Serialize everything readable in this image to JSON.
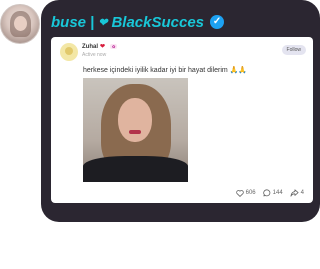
{
  "header": {
    "name_left": "buse",
    "separator": "|",
    "heart": "❤",
    "name_right": "BlackSucces",
    "verified_glyph": "✓"
  },
  "post": {
    "author": "Zuhal",
    "author_heart": "❤",
    "badge": "✿",
    "time": "Active now",
    "follow_label": "Follow",
    "text": "herkese içindeki iyilik kadar iyi bir hayat dilerim",
    "text_emoji": "🙏🙏",
    "likes": "606",
    "comments": "144",
    "shares": "4"
  },
  "colors": {
    "bubble_bg": "#2b2631",
    "name_color": "#19c7d8",
    "verified": "#1da1f2"
  },
  "icons": [
    "heart-outline-icon",
    "comment-icon",
    "share-icon",
    "verified-icon"
  ]
}
